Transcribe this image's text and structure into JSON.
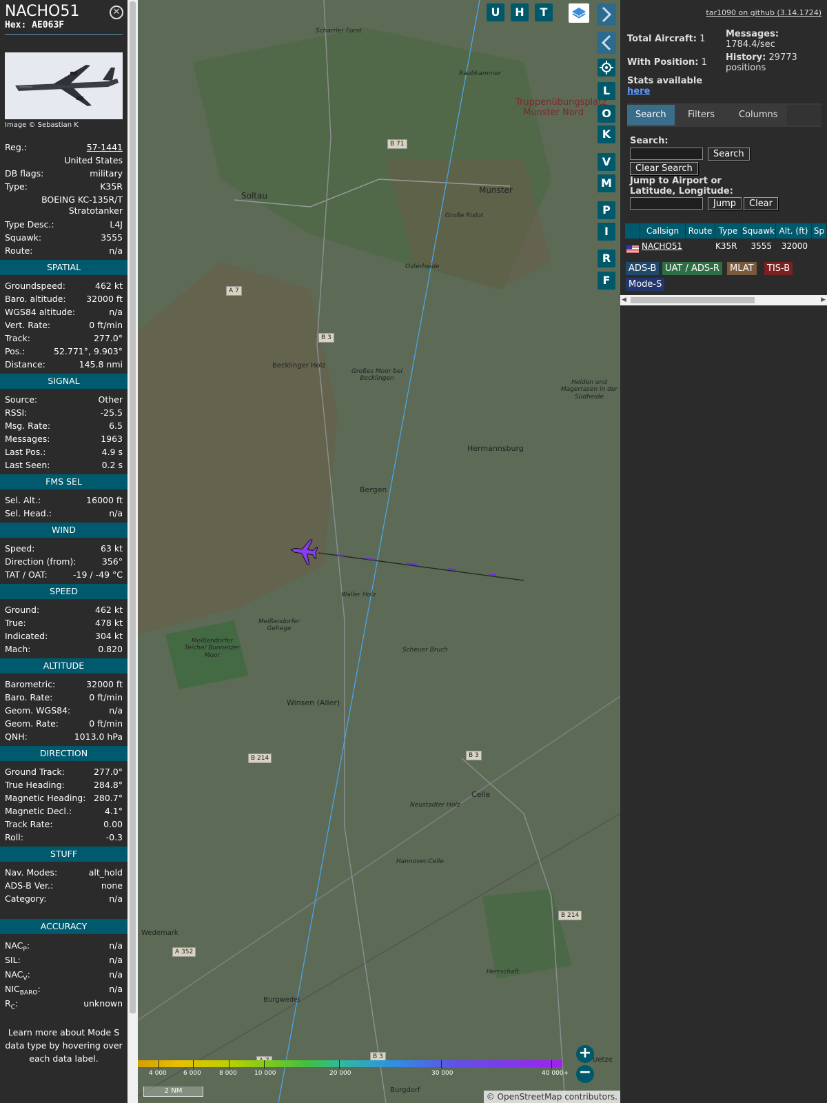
{
  "aircraft": {
    "callsign": "NACHO51",
    "hex_label": "Hex:",
    "hex": "AE063F",
    "photo_credit": "Image © Sebastian K"
  },
  "info": [
    {
      "k": "Reg.:",
      "v": "57-1441",
      "link": true
    },
    {
      "k": "",
      "v": "United States"
    },
    {
      "k": "DB flags:",
      "v": "military"
    },
    {
      "k": "Type:",
      "v": "K35R"
    },
    {
      "k": "",
      "v": "BOEING KC-135R/T Stratotanker"
    },
    {
      "k": "Type Desc.:",
      "v": "L4J"
    },
    {
      "k": "Squawk:",
      "v": "3555"
    },
    {
      "k": "Route:",
      "v": "n/a"
    }
  ],
  "sections": [
    {
      "title": "SPATIAL",
      "rows": [
        [
          "Groundspeed:",
          "462 kt"
        ],
        [
          "Baro. altitude:",
          "32000 ft"
        ],
        [
          "WGS84 altitude:",
          "n/a"
        ],
        [
          "Vert. Rate:",
          "0 ft/min"
        ],
        [
          "Track:",
          "277.0°"
        ],
        [
          "Pos.:",
          "52.771°, 9.903°"
        ],
        [
          "Distance:",
          "145.8 nmi"
        ]
      ]
    },
    {
      "title": "SIGNAL",
      "rows": [
        [
          "Source:",
          "Other"
        ],
        [
          "RSSI:",
          "-25.5"
        ],
        [
          "Msg. Rate:",
          "6.5"
        ],
        [
          "Messages:",
          "1963"
        ],
        [
          "Last Pos.:",
          "4.9 s"
        ],
        [
          "Last Seen:",
          "0.2 s"
        ]
      ]
    },
    {
      "title": "FMS SEL",
      "rows": [
        [
          "Sel. Alt.:",
          "16000 ft"
        ],
        [
          "Sel. Head.:",
          "n/a"
        ]
      ]
    },
    {
      "title": "WIND",
      "rows": [
        [
          "Speed:",
          "63 kt"
        ],
        [
          "Direction (from):",
          "356°"
        ],
        [
          "TAT / OAT:",
          "-19 / -49 °C"
        ]
      ]
    },
    {
      "title": "SPEED",
      "rows": [
        [
          "Ground:",
          "462 kt"
        ],
        [
          "True:",
          "478 kt"
        ],
        [
          "Indicated:",
          "304 kt"
        ],
        [
          "Mach:",
          "0.820"
        ]
      ]
    },
    {
      "title": "ALTITUDE",
      "rows": [
        [
          "Barometric:",
          "32000 ft"
        ],
        [
          "Baro. Rate:",
          "0 ft/min"
        ],
        [
          "Geom. WGS84:",
          "n/a"
        ],
        [
          "Geom. Rate:",
          "0 ft/min"
        ],
        [
          "QNH:",
          "1013.0 hPa"
        ]
      ]
    },
    {
      "title": "DIRECTION",
      "rows": [
        [
          "Ground Track:",
          "277.0°"
        ],
        [
          "True Heading:",
          "284.8°"
        ],
        [
          "Magnetic Heading:",
          "280.7°"
        ],
        [
          "Magnetic Decl.:",
          "4.1°"
        ],
        [
          "Track Rate:",
          "0.00"
        ],
        [
          "Roll:",
          "-0.3"
        ]
      ]
    },
    {
      "title": "STUFF",
      "rows": [
        [
          "Nav. Modes:",
          "alt_hold"
        ],
        [
          "ADS-B Ver.:",
          "none"
        ],
        [
          "Category:",
          "n/a"
        ]
      ]
    }
  ],
  "accuracy": {
    "title": "ACCURACY",
    "rows": [
      [
        "NAC",
        "P",
        ":",
        "n/a"
      ],
      [
        "SIL:",
        "",
        "",
        "n/a"
      ],
      [
        "NAC",
        "V",
        ":",
        "n/a"
      ],
      [
        "NIC",
        "BARO",
        ":",
        "n/a"
      ],
      [
        "R",
        "C",
        ":",
        "unknown"
      ]
    ]
  },
  "footnote": "Learn more about Mode S data type by hovering over each data label.",
  "map": {
    "buttons_top": [
      "U",
      "H",
      "T"
    ],
    "buttons_side": [
      "L",
      "O",
      "K",
      "V",
      "M",
      "P",
      "I",
      "R",
      "F"
    ],
    "places": [
      {
        "t": "Soltau"
      },
      {
        "t": "Munster"
      },
      {
        "t": "Truppenübungsplatz Munster Nord"
      },
      {
        "t": "Becklinger Holz"
      },
      {
        "t": "Großes Moor bei Becklingen"
      },
      {
        "t": "Hermannsburg"
      },
      {
        "t": "Bergen"
      },
      {
        "t": "Waller Holz"
      },
      {
        "t": "Meißendorfer Gehege"
      },
      {
        "t": "Meißendorfer Teiche/ Bonnetzer Moor"
      },
      {
        "t": "Scheuer Bruch"
      },
      {
        "t": "Winsen (Aller)"
      },
      {
        "t": "Neustadter Holz"
      },
      {
        "t": "Celle"
      },
      {
        "t": "Wedemark"
      },
      {
        "t": "Burgwedel"
      },
      {
        "t": "Burgdorf"
      },
      {
        "t": "Herrschaft"
      },
      {
        "t": "Scharrler Forst"
      },
      {
        "t": "Raubkammer"
      },
      {
        "t": "Große Rislot"
      },
      {
        "t": "Osterheide"
      },
      {
        "t": "Heiden und Magerrasen in der Südheide"
      },
      {
        "t": "Uetze"
      },
      {
        "t": "Hannover-Celle"
      }
    ],
    "roads": [
      "B 71",
      "A 7",
      "B 3",
      "B 214",
      "B 3",
      "B 214",
      "A 352",
      "B 3",
      "A 7"
    ],
    "scale_label": "2 NM",
    "alt_ticks": [
      "4 000",
      "6 000",
      "8 000",
      "10 000",
      "20 000",
      "30 000",
      "40 000+"
    ],
    "attribution": "© OpenStreetMap contributors."
  },
  "panel": {
    "github": "tar1090 on github (3.14.1724)",
    "total_label": "Total Aircraft:",
    "total": "1",
    "pos_label": "With Position:",
    "pos": "1",
    "msg_label": "Messages:",
    "msg": "1784.4/sec",
    "hist_label": "History:",
    "hist": "29773 positions",
    "stats_label": "Stats available",
    "stats_link": "here",
    "tabs": [
      "Search",
      "Filters",
      "Columns"
    ],
    "search_label": "Search:",
    "search_btn": "Search",
    "clear_search": "Clear Search",
    "jump_label": "Jump to Airport or Latitude, Longitude:",
    "jump_btn": "Jump",
    "clear_btn": "Clear",
    "table_headers": [
      "Callsign",
      "Route",
      "Type",
      "Squawk",
      "Alt. (ft)",
      "Sp"
    ],
    "table_row": [
      "NACHO51",
      "",
      "K35R",
      "3555",
      "32000",
      ""
    ],
    "badges": [
      {
        "t": "ADS-B",
        "c": "#1f4a6e"
      },
      {
        "t": "UAT / ADS-R",
        "c": "#2f6e45"
      },
      {
        "t": "MLAT",
        "c": "#7a5a3c"
      },
      {
        "t": "TIS-B",
        "c": "#7a2020"
      },
      {
        "t": "Mode-S",
        "c": "#23366e"
      }
    ]
  }
}
